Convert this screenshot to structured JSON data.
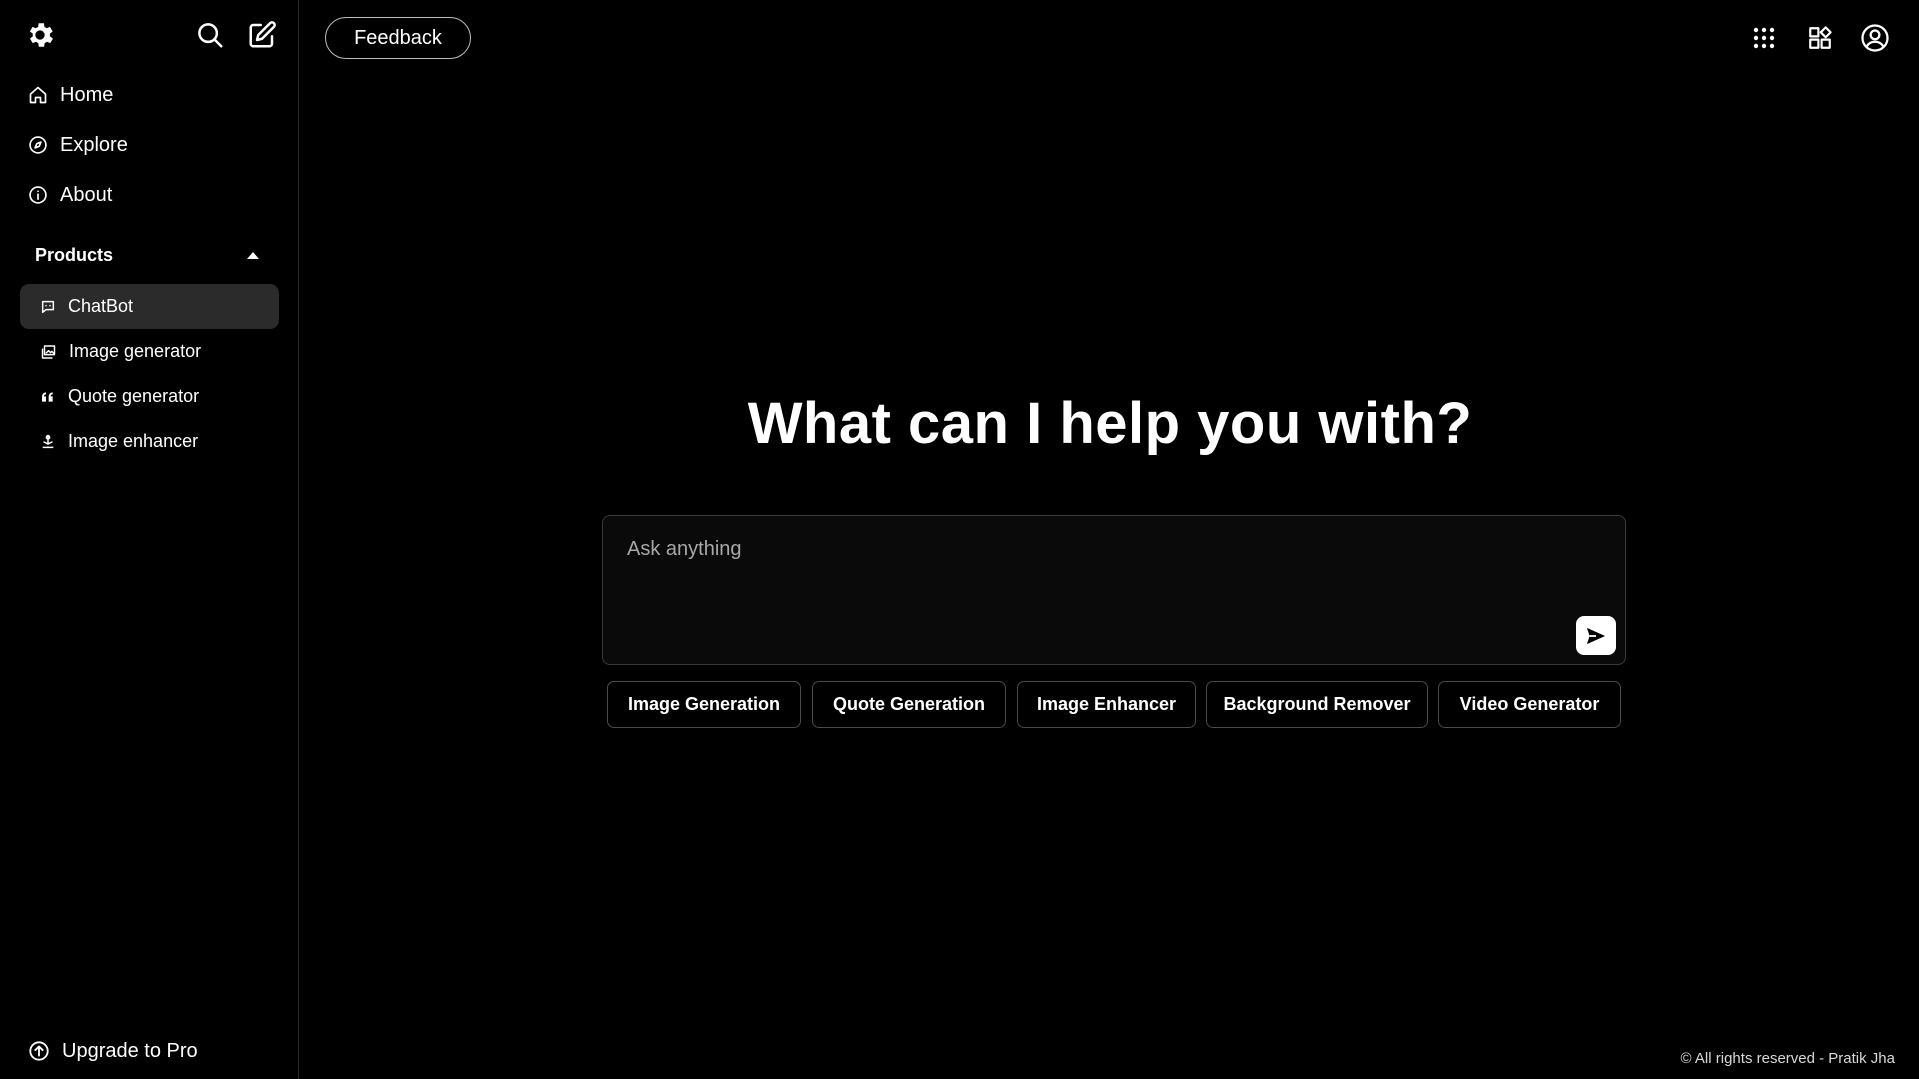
{
  "sidebar": {
    "logo_icon": "gear-logo-icon",
    "search_icon": "search-icon",
    "new_chat_icon": "edit-icon",
    "nav": [
      {
        "label": "Home",
        "icon": "home-icon"
      },
      {
        "label": "Explore",
        "icon": "compass-icon"
      },
      {
        "label": "About",
        "icon": "info-icon"
      }
    ],
    "products_heading": "Products",
    "products": [
      {
        "label": "ChatBot",
        "icon": "chat-icon",
        "active": true
      },
      {
        "label": "Image generator",
        "icon": "images-icon",
        "active": false
      },
      {
        "label": "Quote generator",
        "icon": "quote-icon",
        "active": false
      },
      {
        "label": "Image enhancer",
        "icon": "enhance-icon",
        "active": false
      }
    ],
    "upgrade_label": "Upgrade to Pro"
  },
  "header": {
    "feedback_label": "Feedback",
    "apps_icon": "grid-dots-icon",
    "widgets_icon": "widgets-icon",
    "account_icon": "account-icon"
  },
  "main": {
    "headline": "What can I help you with?",
    "prompt_placeholder": "Ask anything",
    "send_icon": "send-icon",
    "chips": [
      "Image Generation",
      "Quote Generation",
      "Image Enhancer",
      "Background Remover",
      "Video Generator"
    ]
  },
  "footer": {
    "text": "© All rights reserved - Pratik Jha"
  },
  "colors": {
    "background": "#000000",
    "active_item": "#2b2b2b",
    "text": "#ffffff",
    "border": "#4a4a4a"
  }
}
